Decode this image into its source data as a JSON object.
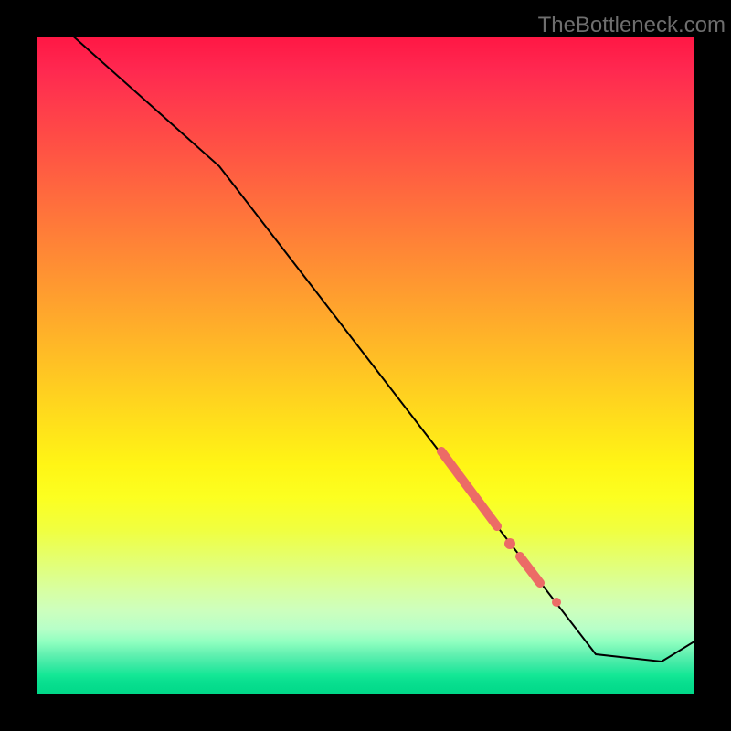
{
  "watermark_text": "TheBottleneck.com",
  "chart_data": {
    "type": "line",
    "title": "",
    "xlabel": "",
    "ylabel": "",
    "xlim": [
      0,
      100
    ],
    "ylim": [
      0,
      100
    ],
    "series": [
      {
        "name": "curve",
        "points": [
          {
            "x": 0,
            "y": 105
          },
          {
            "x": 28,
            "y": 80
          },
          {
            "x": 85,
            "y": 6
          },
          {
            "x": 95,
            "y": 5
          },
          {
            "x": 100,
            "y": 8
          }
        ]
      },
      {
        "name": "highlight-segment-1",
        "points": [
          {
            "x": 61.5,
            "y": 37
          },
          {
            "x": 70,
            "y": 25.5
          }
        ]
      },
      {
        "name": "highlight-segment-2",
        "points": [
          {
            "x": 73.5,
            "y": 21
          },
          {
            "x": 76.5,
            "y": 17
          }
        ]
      }
    ],
    "highlight_dots": [
      {
        "x": 72,
        "y": 23
      },
      {
        "x": 79,
        "y": 14
      }
    ],
    "gradient_stops": [
      {
        "pos": 0,
        "color": "#ff1744"
      },
      {
        "pos": 50,
        "color": "#ffc224"
      },
      {
        "pos": 75,
        "color": "#f0ff40"
      },
      {
        "pos": 100,
        "color": "#00d888"
      }
    ]
  }
}
